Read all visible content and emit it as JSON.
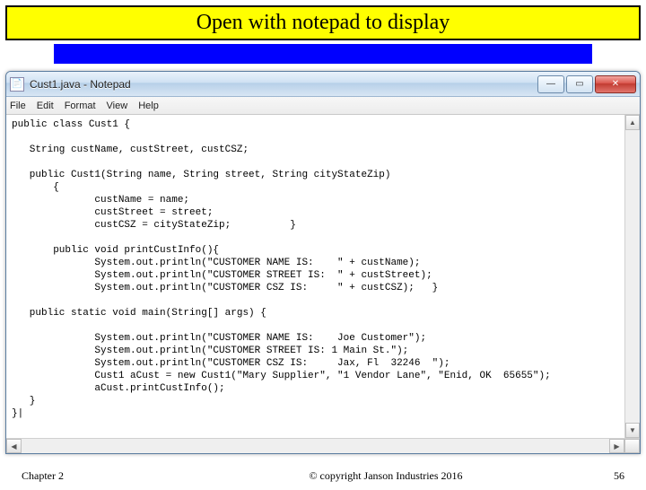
{
  "slide": {
    "banner": "Open with notepad to display",
    "chapter": "Chapter 2",
    "copyright": "© copyright Janson Industries 2016",
    "page": "56"
  },
  "window": {
    "title": "Cust1.java - Notepad",
    "icon_glyph": "📄",
    "buttons": {
      "min": "—",
      "max": "▭",
      "close": "✕"
    }
  },
  "menu": {
    "file": "File",
    "edit": "Edit",
    "format": "Format",
    "view": "View",
    "help": "Help"
  },
  "code": "public class Cust1 {\n\n   String custName, custStreet, custCSZ;\n\n   public Cust1(String name, String street, String cityStateZip)\n       {\n              custName = name;\n              custStreet = street;\n              custCSZ = cityStateZip;          }\n\n       public void printCustInfo(){\n              System.out.println(\"CUSTOMER NAME IS:    \" + custName);\n              System.out.println(\"CUSTOMER STREET IS:  \" + custStreet);\n              System.out.println(\"CUSTOMER CSZ IS:     \" + custCSZ);   }\n\n   public static void main(String[] args) {\n\n              System.out.println(\"CUSTOMER NAME IS:    Joe Customer\");\n              System.out.println(\"CUSTOMER STREET IS: 1 Main St.\");\n              System.out.println(\"CUSTOMER CSZ IS:     Jax, Fl  32246  \");\n              Cust1 aCust = new Cust1(\"Mary Supplier\", \"1 Vendor Lane\", \"Enid, OK  65655\");\n              aCust.printCustInfo();\n   }\n}|"
}
